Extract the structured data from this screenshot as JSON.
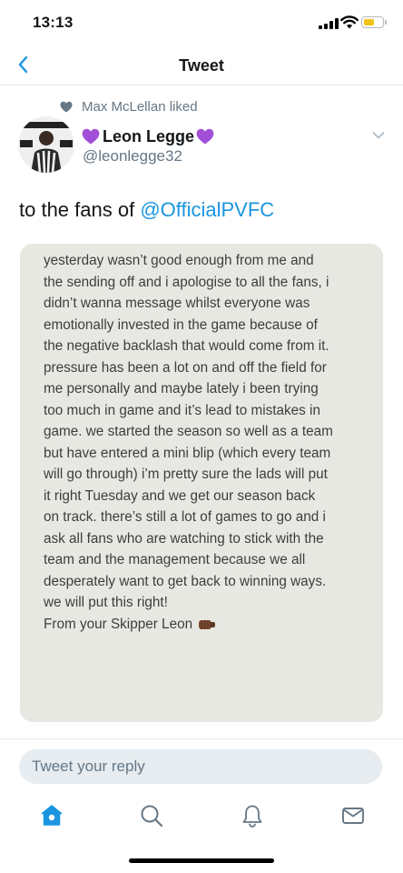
{
  "status_bar": {
    "time": "13:13",
    "battery_color": "#f2c418"
  },
  "nav": {
    "title": "Tweet",
    "back_icon": "chevron-left-icon"
  },
  "tweet": {
    "social_context": "Max McLellan liked",
    "display_name": "Leon Legge",
    "name_emoji": "purple-heart",
    "handle": "@leonlegge32",
    "text_prefix": "to the fans of ",
    "mention": "@OfficialPVFC",
    "attached_note": {
      "lines": [
        "yesterday wasn’t good enough from me and",
        "the sending off and i apologise to all the fans, i",
        "didn’t wanna message whilst everyone was",
        "emotionally invested in the game because of",
        "the negative backlash that would come from it.",
        "pressure has been a lot on and off the field for",
        "me personally and maybe lately i been trying",
        "too much in game and it’s lead to mistakes in",
        "game. we started the season so well as a team",
        "but have entered a mini blip (which every team",
        "will go through) i’m pretty sure the lads will put",
        "it right Tuesday and we get our season back",
        "on track. there’s still a lot of games to go and i",
        "ask all fans who are watching to stick with the",
        "team and the management because we all",
        "desperately want to get back to winning ways.",
        "we will put this right!"
      ],
      "sign_off": "From your Skipper Leon",
      "sign_off_emoji": "fist-icon"
    }
  },
  "reply": {
    "placeholder": "Tweet your reply"
  },
  "tab_bar": {
    "active_tab": "home",
    "tabs": [
      "home-icon",
      "search-icon",
      "bell-icon",
      "mail-icon"
    ]
  },
  "colors": {
    "accent": "#1b95e0",
    "secondary_text": "#657786",
    "note_background": "#e8e8e3"
  }
}
